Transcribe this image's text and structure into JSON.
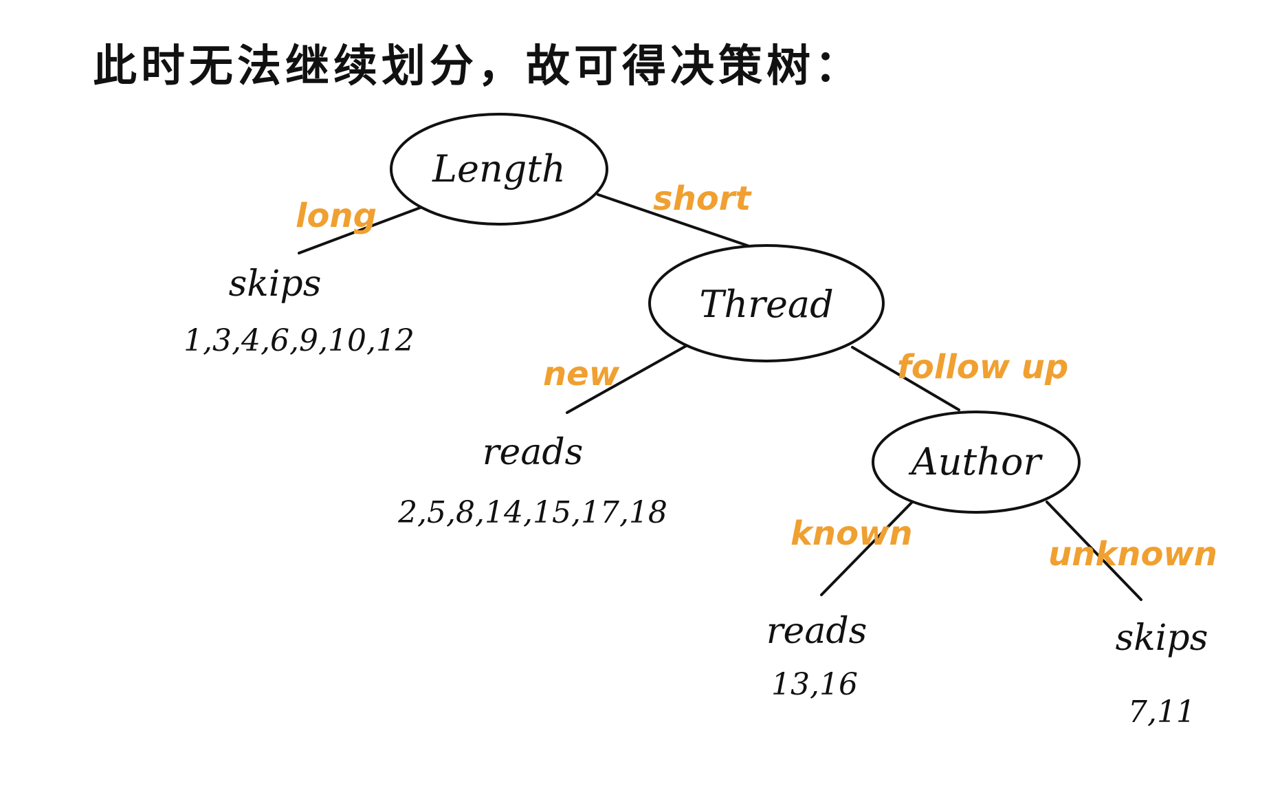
{
  "title": "此时无法继续划分，故可得决策树：",
  "colors": {
    "ink": "#111111",
    "edge_label": "#f0a030",
    "background": "#ffffff"
  },
  "tree": {
    "root": {
      "label": "Length",
      "edges": {
        "long": "long",
        "short": "short"
      }
    },
    "thread": {
      "label": "Thread",
      "edges": {
        "new": "new",
        "follow_up": "follow up"
      }
    },
    "author": {
      "label": "Author",
      "edges": {
        "known": "known",
        "unknown": "unknown"
      }
    },
    "leaves": {
      "long_skips": {
        "label": "skips",
        "ids": "1,3,4,6,9,10,12"
      },
      "new_reads": {
        "label": "reads",
        "ids": "2,5,8,14,15,17,18"
      },
      "known_reads": {
        "label": "reads",
        "ids": "13,16"
      },
      "unknown_skips": {
        "label": "skips",
        "ids": "7,11"
      }
    }
  }
}
